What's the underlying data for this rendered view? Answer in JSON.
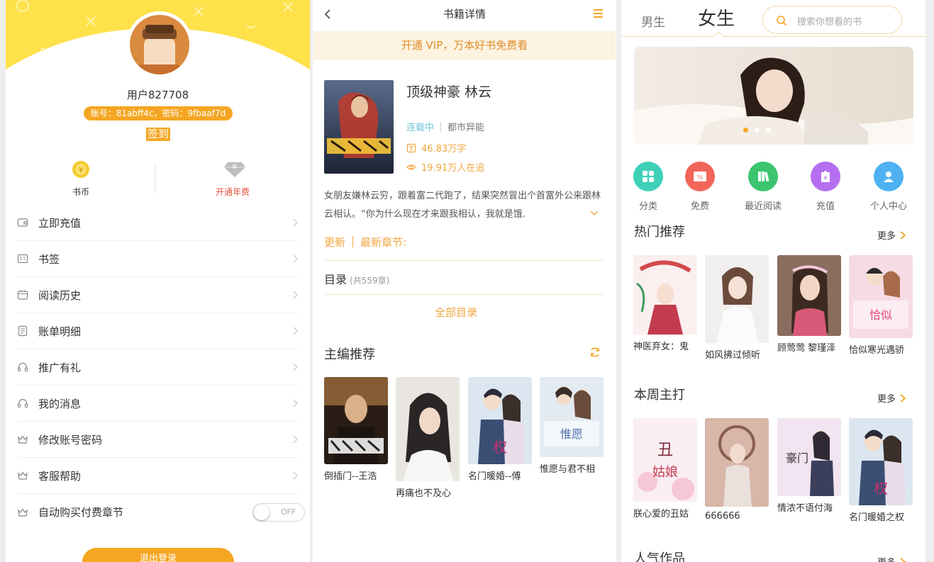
{
  "profile": {
    "username": "用户827708",
    "account_info": "账号：81abff4c，密码：9fbaaf7d",
    "signin_label": "签到",
    "stats": [
      {
        "label": "书币",
        "icon": "coin-icon"
      },
      {
        "label": "开通年费",
        "icon": "diamond-icon"
      }
    ],
    "menu": [
      {
        "label": "立即充值",
        "icon": "wallet-icon"
      },
      {
        "label": "书签",
        "icon": "bookmark-card-icon"
      },
      {
        "label": "阅读历史",
        "icon": "calendar-icon"
      },
      {
        "label": "账单明细",
        "icon": "bill-icon"
      },
      {
        "label": "推广有礼",
        "icon": "headset-icon"
      },
      {
        "label": "我的消息",
        "icon": "headset-icon"
      },
      {
        "label": "修改账号密码",
        "icon": "crown-icon"
      },
      {
        "label": "客服帮助",
        "icon": "crown-icon"
      },
      {
        "label": "自动购买付费章节",
        "icon": "crown-icon"
      }
    ],
    "auto_buy_toggle": "OFF",
    "logout_label": "退出登录",
    "colors": {
      "accent": "#f5a623",
      "header_yellow": "#ffe14a"
    }
  },
  "detail": {
    "page_title": "书籍详情",
    "vip_banner": "开通 VIP，万本好书免费看",
    "book": {
      "title": "顶级神豪 林云",
      "status": "连载中",
      "genre": "都市异能",
      "words": "46.83万字",
      "followers": "19.91万人在追",
      "synopsis": "女朋友嫌林云穷，跟着富二代跑了，结果突然冒出个首富外公来跟林云相认。“你为什么现在才来跟我相认，我就是饿."
    },
    "update_label": "更新",
    "latest_chapter_label": "最新章节:",
    "toc_label": "目录",
    "toc_count": "(共559章)",
    "all_toc_label": "全部目录",
    "recommend_title": "主编推荐",
    "recommendations": [
      {
        "name": "倒插门--王浩"
      },
      {
        "name": "再痛也不及心"
      },
      {
        "name": "名门暖婚--傅"
      },
      {
        "name": "惟愿与君不相"
      }
    ]
  },
  "store": {
    "tab_male": "男生",
    "tab_female": "女生",
    "search_placeholder": "搜索你想看的书",
    "quick_links": [
      {
        "label": "分类",
        "icon": "category-icon",
        "color": "#3fd1b8"
      },
      {
        "label": "免费",
        "icon": "free-ticket-icon",
        "color": "#f2665a"
      },
      {
        "label": "最近阅读",
        "icon": "books-icon",
        "color": "#3cc46e"
      },
      {
        "label": "充值",
        "icon": "recharge-icon",
        "color": "#b46ef0"
      },
      {
        "label": "个人中心",
        "icon": "user-icon",
        "color": "#4eb2f2"
      }
    ],
    "hot_title": "热门推荐",
    "hot_more": "更多",
    "hot_books": [
      {
        "name": "神医弃女：鬼"
      },
      {
        "name": "如风拂过倾听"
      },
      {
        "name": "顾莺莺 黎瑾泽"
      },
      {
        "name": "恰似寒光遇骄"
      }
    ],
    "weekly_title": "本周主打",
    "weekly_more": "更多",
    "weekly_books": [
      {
        "name": "朕心爱的丑姑"
      },
      {
        "name": "666666"
      },
      {
        "name": "情浓不语付海"
      },
      {
        "name": "名门暖婚之权"
      }
    ],
    "popular_title": "人气作品",
    "popular_more": "更多"
  }
}
